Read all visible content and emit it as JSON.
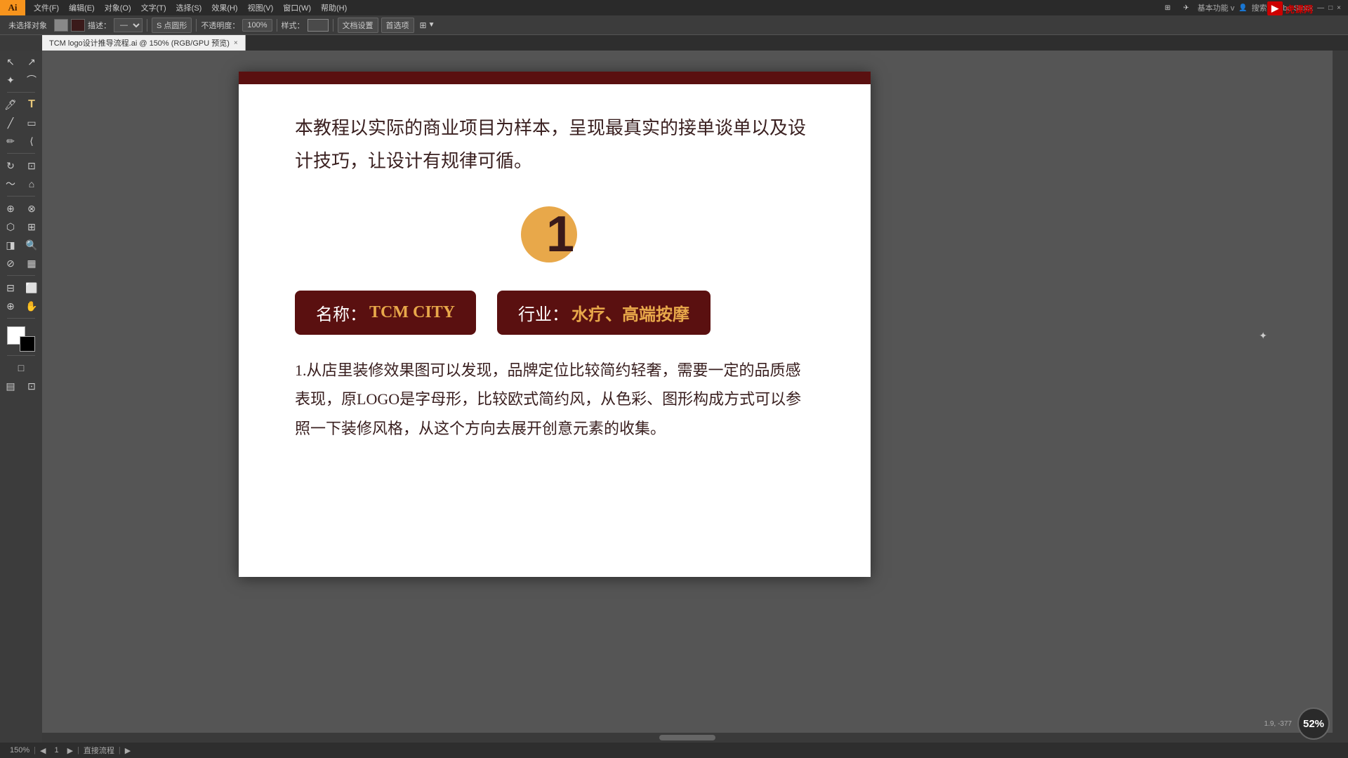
{
  "app": {
    "title": "Ai",
    "logo_color": "#f7941d"
  },
  "menu": {
    "items": [
      "文件(F)",
      "编辑(E)",
      "对象(O)",
      "文字(T)",
      "选择(S)",
      "效果(H)",
      "视图(V)",
      "窗口(W)",
      "帮助(H)"
    ]
  },
  "top_right": {
    "label": "基本功能 v",
    "search_placeholder": "搜索 Adobe Stock"
  },
  "toolbar": {
    "mode_label": "未选择对象",
    "color_label": "描述：",
    "opacity_label": "不透明度：",
    "opacity_value": "100%",
    "style_label": "样式：",
    "doc_settings": "文档设置",
    "preferences": "首选项",
    "shape_label": "S 点圆形",
    "align_label": "对齐"
  },
  "tab": {
    "filename": "TCM logo设计推导流程.ai @ 150% (RGB/GPU 预览)",
    "close": "×"
  },
  "canvas": {
    "zoom": "150%",
    "page_indicator": "1",
    "page_label": "直接流程",
    "scroll_position": "50%"
  },
  "document": {
    "intro_text": "本教程以实际的商业项目为样本，呈现最真实的接单谈单以及设计技巧，让设计有规律可循。",
    "number": "1",
    "tag1_label": "名称：",
    "tag1_value": "TCM CITY",
    "tag2_label": "行业：",
    "tag2_value": "水疗、高端按摩",
    "body_text": "1.从店里装修效果图可以发现，品牌定位比较简约轻奢，需要一定的品质感表现，原LOGO是字母形，比较欧式简约风，从色彩、图形构成方式可以参照一下装修风格，从这个方向去展开创意元素的收集。",
    "colors": {
      "dark_red": "#5a1010",
      "orange": "#e8a84a",
      "text": "#3a2020"
    }
  },
  "status_bar": {
    "zoom": "150%",
    "page_nav_prev": "◀",
    "page_num": "1",
    "page_nav_next": "▶",
    "page_label": "直接流程",
    "progress": "▶"
  },
  "bottom_right": {
    "coords": "1.9, -377",
    "percentage": "52%"
  },
  "watermark": {
    "logo_text": "虎课网",
    "icon": "▶"
  }
}
